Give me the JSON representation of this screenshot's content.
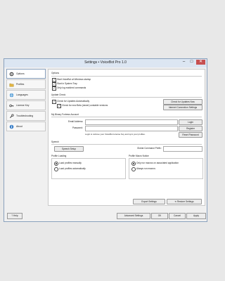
{
  "window": {
    "title": "Settings • VoiceBot Pro 1.0"
  },
  "sidebar": {
    "items": [
      {
        "label": "Options",
        "icon": "gear-icon"
      },
      {
        "label": "Profiles",
        "icon": "folder-icon"
      },
      {
        "label": "Languages",
        "icon": "globe-icon"
      },
      {
        "label": "License Key",
        "icon": "key-icon"
      },
      {
        "label": "Troubleshooting",
        "icon": "wrench-icon"
      },
      {
        "label": "About",
        "icon": "info-icon"
      }
    ]
  },
  "options": {
    "header": "Options",
    "items": [
      {
        "label": "Start VoiceBot at Windows startup",
        "checked": true
      },
      {
        "label": "Start in System Tray",
        "checked": true
      },
      {
        "label": "Only log matched commands",
        "checked": true
      }
    ]
  },
  "update": {
    "header": "Update Check",
    "check_auto": "Check for Updates Automatically",
    "check_beta": "Check for new Beta (newer) unstable versions",
    "check_now_btn": "Check for Updates Now",
    "internet_btn": "Internet Connection Settings"
  },
  "account": {
    "header": "My Binary Fortress Account",
    "email_label": "Email Address:",
    "email_value": "",
    "password_label": "Password:",
    "password_value": "",
    "login_btn": "Login",
    "register_btn": "Register",
    "info": "Login to retrieve your VoiceBot License Key and sync your profiles.",
    "reset_btn": "Reset Password"
  },
  "speech": {
    "header": "Speech",
    "setup_btn": "Speech Setup",
    "prefix_label": "Global Command Prefix:",
    "prefix_value": ""
  },
  "profile_loading": {
    "header": "Profile Loading",
    "options": [
      {
        "label": "Load profiles manually",
        "selected": true
      },
      {
        "label": "Load profiles automatically",
        "selected": false
      }
    ]
  },
  "profile_macro": {
    "header": "Profile Macro Notice",
    "options": [
      {
        "label": "Only run macros on associated application",
        "selected": true
      },
      {
        "label": "Always run macros",
        "selected": false
      }
    ]
  },
  "panel_buttons": {
    "export": "Export Settings",
    "restore": "Restore Settings"
  },
  "footer": {
    "help": "Help",
    "advanced": "Advanced Settings",
    "ok": "OK",
    "cancel": "Cancel",
    "apply": "Apply"
  }
}
